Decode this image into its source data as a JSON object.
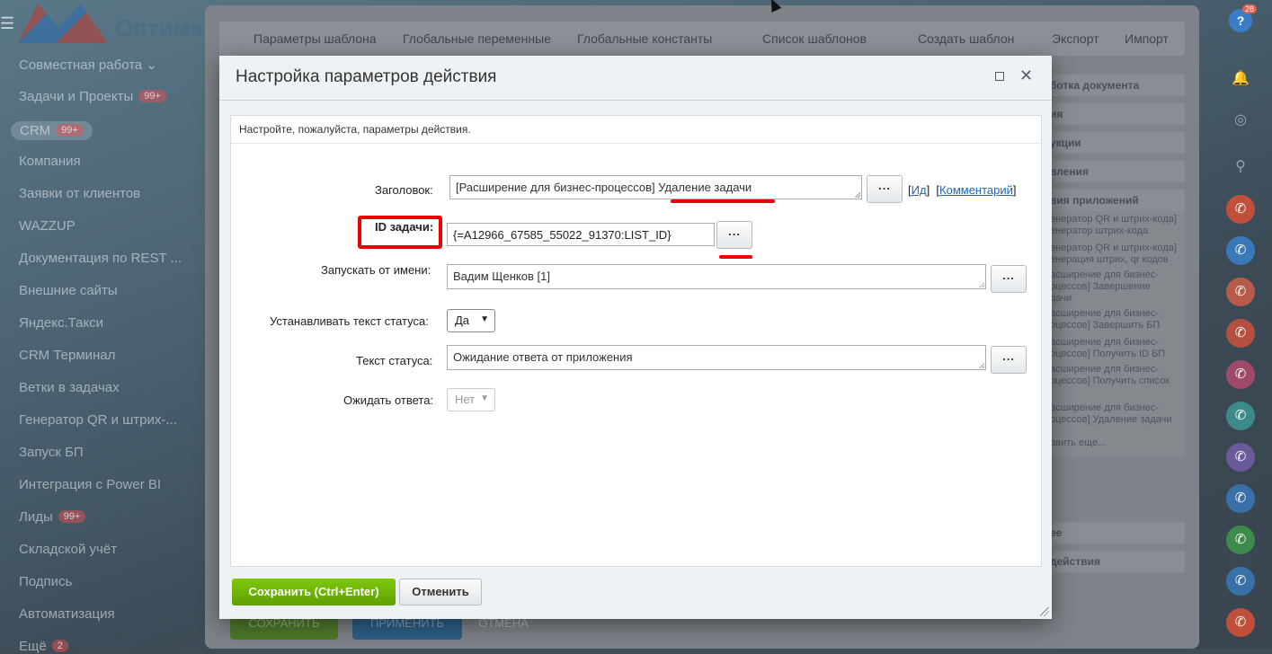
{
  "background": {
    "logo_text": "Оптима",
    "sidebar_items": [
      {
        "label": "Совместная работа",
        "chevron": true
      },
      {
        "label": "Задачи и Проекты",
        "badge": "99+"
      },
      {
        "label": "CRM",
        "badge": "99+"
      },
      {
        "label": "Компания"
      },
      {
        "label": "Заявки от клиентов"
      },
      {
        "label": "WAZZUP"
      },
      {
        "label": "Документация по REST ..."
      },
      {
        "label": "Внешние сайты"
      },
      {
        "label": "Яндекс.Такси"
      },
      {
        "label": "CRM Терминал"
      },
      {
        "label": "Ветки в задачах"
      },
      {
        "label": "Генератор QR и штрих-..."
      },
      {
        "label": "Запуск БП"
      },
      {
        "label": "Интеграция с Power BI"
      },
      {
        "label": "Лиды",
        "badge": "99+"
      },
      {
        "label": "Складской учёт"
      },
      {
        "label": "Подпись"
      },
      {
        "label": "Автоматизация"
      },
      {
        "label": "Ещё",
        "badge": "2"
      }
    ],
    "top_tabs": [
      "Параметры шаблона",
      "Глобальные переменные",
      "Глобальные константы",
      "Список шаблонов",
      "Создать шаблон",
      "Экспорт",
      "Импорт"
    ],
    "right_panel_rows": [
      "ботка документа",
      "ия",
      "укции",
      "вления",
      "вия приложений",
      "ее",
      "действия"
    ],
    "right_panel_lines": [
      "енератор QR и штрих-кода]",
      "енератор штрих-кода",
      "енератор QR и штрих-кода]",
      "енерация штрих, qr кодов",
      "асширение для бизнес-",
      "оцессов] Завершение",
      "дачи",
      "асширение для бизнес-",
      "оцессов] Завершить БП",
      "асширение для бизнес-",
      "оцессов] Получить ID БП",
      "асширение для бизнес-",
      "оцессов] Получить список",
      "асширение для бизнес-",
      "оцессов] Удаление задачи",
      "авить еще..."
    ],
    "bottom_buttons": [
      "СОХРАНИТЬ",
      "ПРИМЕНИТЬ",
      "ОТМЕНА"
    ],
    "help_badge": "28",
    "help_icon": "?"
  },
  "dialog": {
    "title": "Настройка параметров действия",
    "hint": "Настройте, пожалуйста, параметры действия.",
    "fields": {
      "title": {
        "label": "Заголовок:",
        "value": "[Расширение для бизнес-процессов] Удаление задачи",
        "dots": "...",
        "id_link": "Ид",
        "comment_link": "Комментарий"
      },
      "task_id": {
        "label": "ID задачи:",
        "value": "{=A12966_67585_55022_91370:LIST_ID}",
        "dots": "..."
      },
      "run_as": {
        "label": "Запускать от имени:",
        "value": "Вадим Щенков [1]",
        "dots": "..."
      },
      "set_status": {
        "label": "Устанавливать текст статуса:",
        "value": "Да"
      },
      "status_text": {
        "label": "Текст статуса:",
        "value": "Ожидание ответа от приложения",
        "dots": "..."
      },
      "wait_reply": {
        "label": "Ожидать ответа:",
        "value": "Нет"
      }
    },
    "save_label": "Сохранить (Ctrl+Enter)",
    "cancel_label": "Отменить"
  },
  "colors": {
    "accent_green": "#6cb505",
    "highlight_red": "#e00000",
    "link_blue": "#2067b0"
  }
}
